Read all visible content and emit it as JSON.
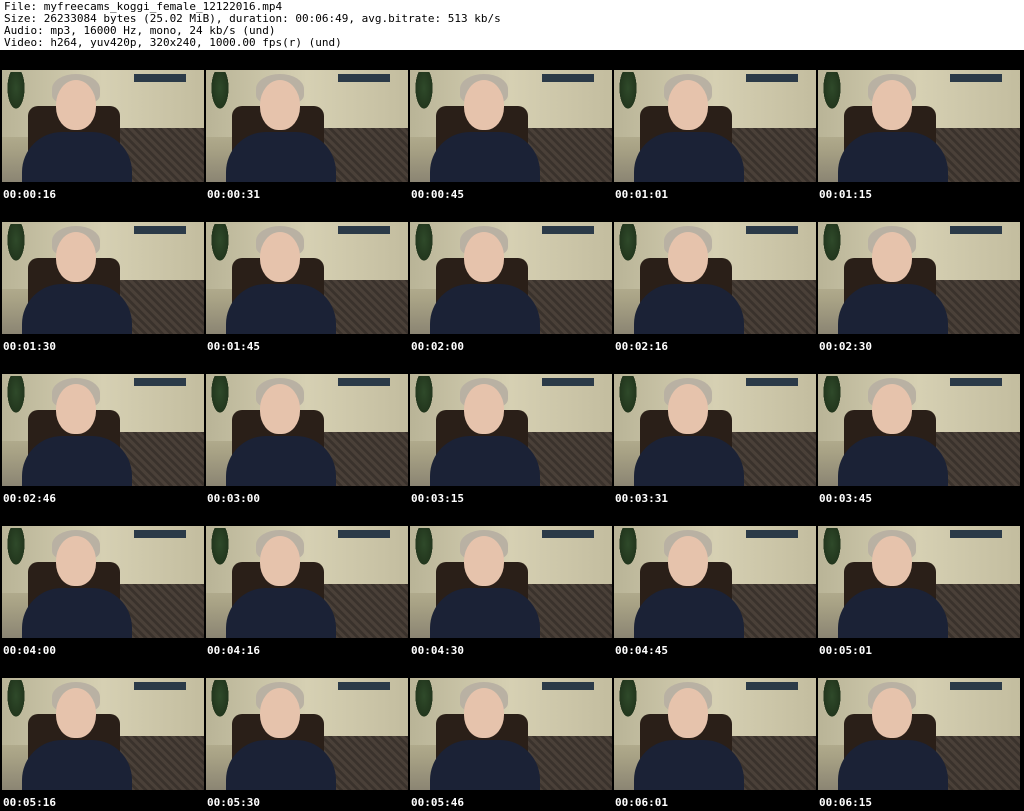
{
  "header": {
    "file": "File: myfreecams_koggi_female_12122016.mp4",
    "size": "Size: 26233084 bytes (25.02 MiB), duration: 00:06:49, avg.bitrate: 513 kb/s",
    "audio": "Audio: mp3, 16000 Hz, mono, 24 kb/s (und)",
    "video": "Video: h264, yuv420p, 320x240, 1000.00 fps(r) (und)"
  },
  "thumbnails": [
    {
      "timestamp": "00:00:16"
    },
    {
      "timestamp": "00:00:31"
    },
    {
      "timestamp": "00:00:45"
    },
    {
      "timestamp": "00:01:01"
    },
    {
      "timestamp": "00:01:15"
    },
    {
      "timestamp": "00:01:30"
    },
    {
      "timestamp": "00:01:45"
    },
    {
      "timestamp": "00:02:00"
    },
    {
      "timestamp": "00:02:16"
    },
    {
      "timestamp": "00:02:30"
    },
    {
      "timestamp": "00:02:46"
    },
    {
      "timestamp": "00:03:00"
    },
    {
      "timestamp": "00:03:15"
    },
    {
      "timestamp": "00:03:31"
    },
    {
      "timestamp": "00:03:45"
    },
    {
      "timestamp": "00:04:00"
    },
    {
      "timestamp": "00:04:16"
    },
    {
      "timestamp": "00:04:30"
    },
    {
      "timestamp": "00:04:45"
    },
    {
      "timestamp": "00:05:01"
    },
    {
      "timestamp": "00:05:16"
    },
    {
      "timestamp": "00:05:30"
    },
    {
      "timestamp": "00:05:46"
    },
    {
      "timestamp": "00:06:01"
    },
    {
      "timestamp": "00:06:15"
    }
  ],
  "colors": {
    "background": "#000000",
    "timestamp_text": "#ffffff",
    "header_text": "#000000"
  }
}
